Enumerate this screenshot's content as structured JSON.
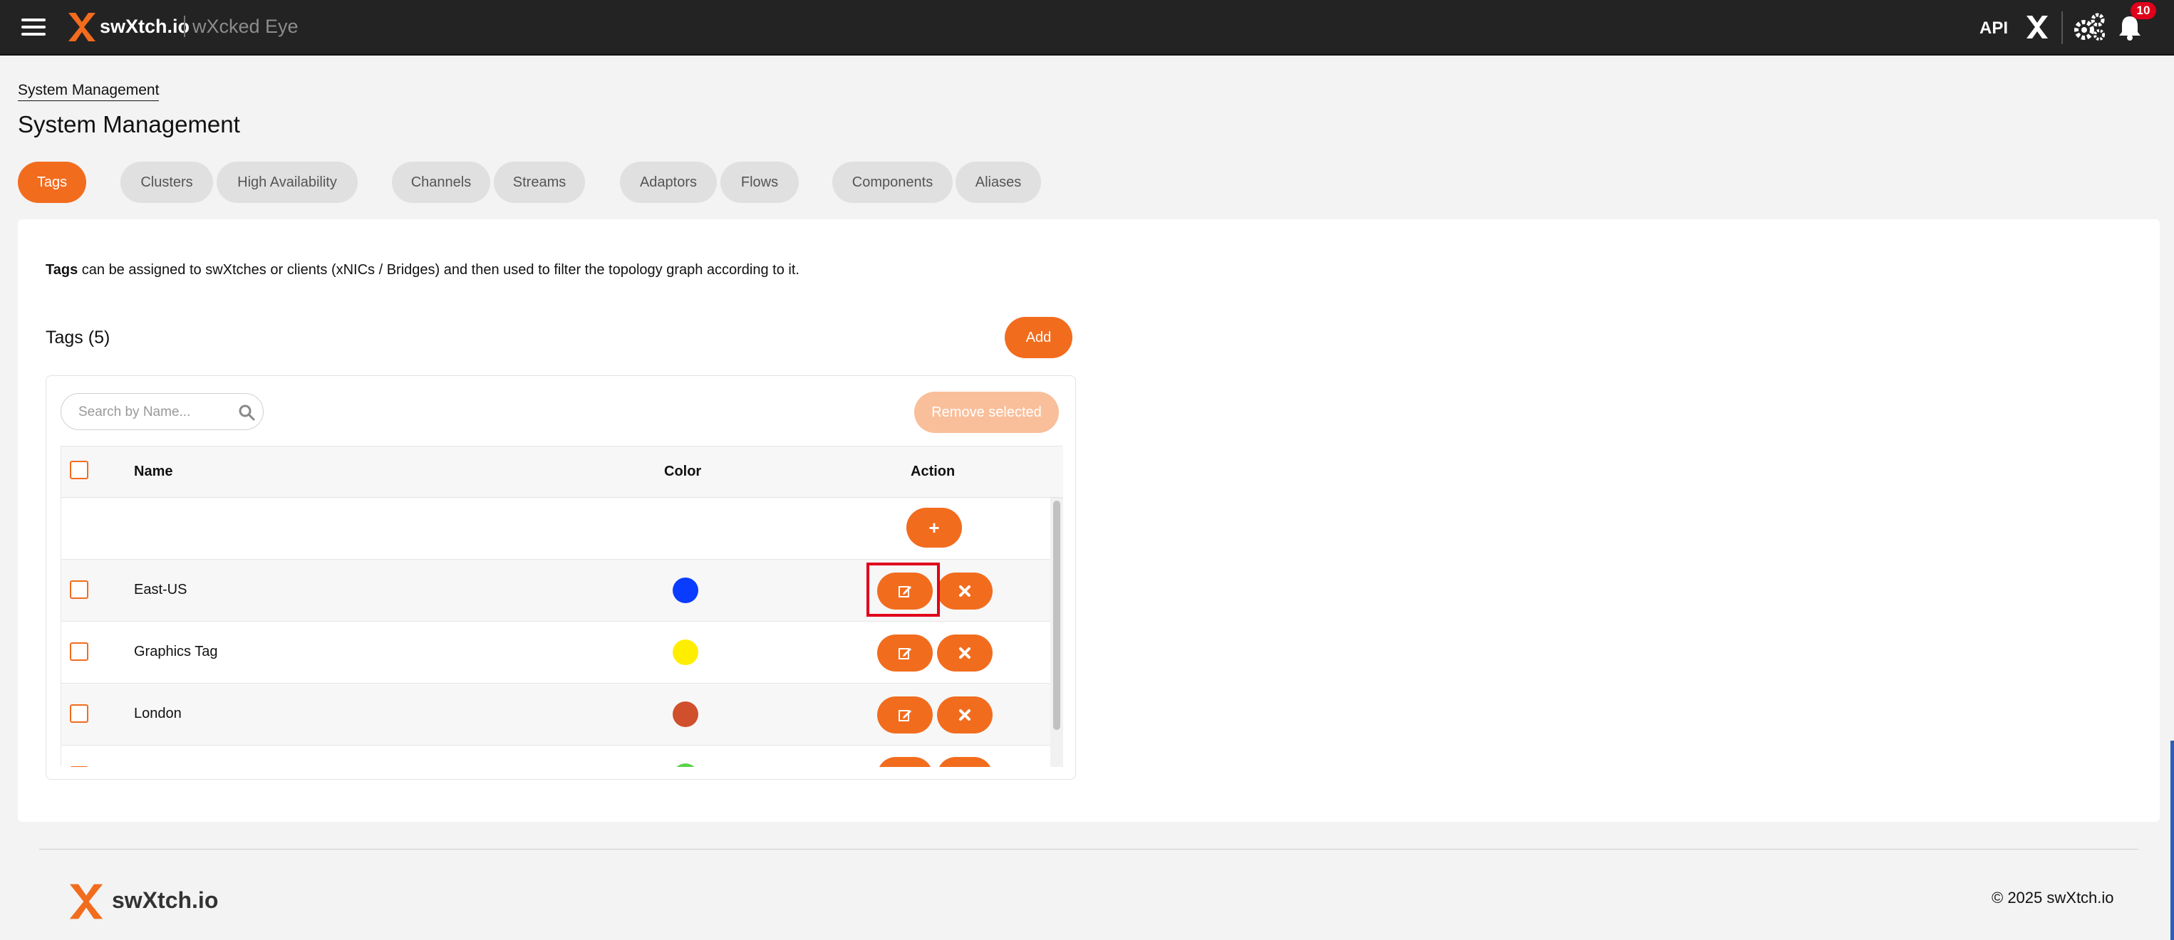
{
  "header": {
    "brand": "swXtch.io",
    "product": "wXcked Eye",
    "api_label": "API",
    "notification_count": "10"
  },
  "page": {
    "breadcrumb": "System Management",
    "title": "System Management"
  },
  "tabs": [
    {
      "label": "Tags",
      "active": true
    },
    {
      "label": "Clusters",
      "active": false
    },
    {
      "label": "High Availability",
      "active": false
    },
    {
      "label": "Channels",
      "active": false
    },
    {
      "label": "Streams",
      "active": false
    },
    {
      "label": "Adaptors",
      "active": false
    },
    {
      "label": "Flows",
      "active": false
    },
    {
      "label": "Components",
      "active": false
    },
    {
      "label": "Aliases",
      "active": false
    }
  ],
  "tags_section": {
    "description_bold": "Tags",
    "description_rest": " can be assigned to swXtches or clients (xNICs / Bridges) and then used to filter the topology graph according to it.",
    "title": "Tags (5)",
    "add_label": "Add",
    "search_placeholder": "Search by Name...",
    "remove_selected_label": "Remove selected",
    "columns": {
      "name": "Name",
      "color": "Color",
      "action": "Action"
    },
    "new_row_button": "+",
    "rows": [
      {
        "name": "East-US",
        "color": "#0a3cff"
      },
      {
        "name": "Graphics Tag",
        "color": "#ffee00"
      },
      {
        "name": "London",
        "color": "#d04f2d"
      },
      {
        "name": "",
        "color": "#5bd34a"
      }
    ]
  },
  "footer": {
    "brand": "swXtch.io",
    "copyright": "© 2025 swXtch.io"
  },
  "colors": {
    "accent": "#f26c1e",
    "accent_disabled": "#f9bf9b",
    "topbar": "#232323",
    "highlight": "#e0001b"
  }
}
